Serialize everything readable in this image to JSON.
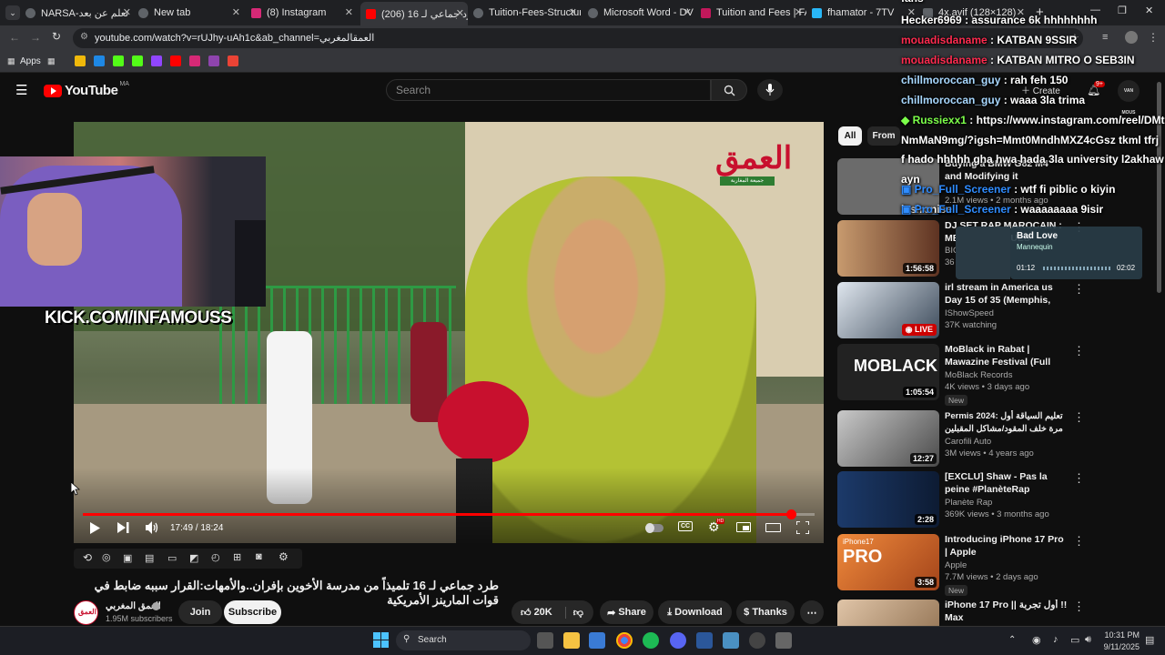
{
  "tabs": [
    {
      "label": "NARSA-تعلم عن بعد",
      "color": "#5f6368"
    },
    {
      "label": "New tab",
      "color": "#5f6368"
    },
    {
      "label": "(8) Instagram",
      "color": "#d62976"
    },
    {
      "label": "طرد جماعي لـ 16 (206)",
      "color": "#ff0000"
    },
    {
      "label": "Tuition-Fees-Structur",
      "color": "#5f6368"
    },
    {
      "label": "Microsoft Word - DV",
      "color": "#5f6368"
    },
    {
      "label": "Tuition and Fees | FA",
      "color": "#c2185b"
    },
    {
      "label": "fhamator - 7TV",
      "color": "#29b6f6"
    },
    {
      "label": "4x.avif (128×128)",
      "color": "#5f6368"
    }
  ],
  "url": "youtube.com/watch?v=rUJhy-uAh1c&ab_channel=العمقالمغربي",
  "bookmarks_label": "Apps",
  "youtube": {
    "logo_text": "YouTube",
    "region": "MA",
    "search_placeholder": "Search",
    "create_label": "Create",
    "notif_count": "9+",
    "avatar_text": "VAN MOUS"
  },
  "chat_overlay": {
    "header": "fans",
    "messages": [
      {
        "user": "Hecker6969",
        "text": "assurance 6k hhhhhhhh",
        "color": "#ffffff"
      },
      {
        "user": "mouadisdaname",
        "text": "KATBAN 9SSIR",
        "color": "#ff2b4f"
      },
      {
        "user": "mouadisdaname",
        "text": "KATBAN MITRO O SEB3IN",
        "color": "#ff2b4f"
      },
      {
        "user": "chillmoroccan_guy",
        "text": "rah feh 150",
        "color": "#a8d8ff"
      },
      {
        "user": "chillmoroccan_guy",
        "text": "waaa 3la trima",
        "color": "#a8d8ff"
      },
      {
        "user": "Russiexx1",
        "text": "https://www.instagram.com/reel/DMtNmMaN9mg/?igsh=Mmt0MndhMXZ4cGsz tkml tfrj f hado hhhhh gha hwa hada 3la university l2akhawayn",
        "color": "#7cff4a"
      },
      {
        "user": "Pro_Full_Screener",
        "text": "wtf fi piblic o kiyin lasironise",
        "color": "#2f8cff"
      },
      {
        "user": "Pro_Full_Screener",
        "text": "waaaaaaaa 9isir",
        "color": "#2f8cff"
      }
    ]
  },
  "now_playing": {
    "title": "Bad Love",
    "artist": "Mannequin",
    "elapsed": "01:12",
    "total": "02:02"
  },
  "stream_overlay": {
    "kick": "KICK.COM/INFAMOUSS"
  },
  "player": {
    "time": "17:49 / 18:24",
    "progress_fraction": 0.968,
    "video_watermark": "العمق",
    "video_subwatermark": "جميعة المغاربة"
  },
  "chips": {
    "all": "All",
    "from": "From"
  },
  "recommendations": [
    {
      "title": "Buying a BMW G82 M4 and Modifying it Immediately",
      "channel": "",
      "meta": "2.1M views • 2 months ago",
      "duration": "",
      "badge": "",
      "thumb": "#6b6b6b"
    },
    {
      "title": "DJ SET RAP MAROCAIN : MES CLASSIQUES",
      "channel": "BIG",
      "meta": "36",
      "duration": "1:56:58",
      "badge": "",
      "thumb": "#7a4a3a"
    },
    {
      "title": "irl stream in America us Day 15 of 35 (Memphis, TN)",
      "channel": "IShowSpeed",
      "meta": "37K watching",
      "duration": "",
      "live": "LIVE",
      "badge": "",
      "thumb": "#3c4a5a"
    },
    {
      "title": "MoBlack in Rabat | Mawazine Festival (Full Set)",
      "channel": "MoBlack Records",
      "meta": "4K views • 3 days ago",
      "duration": "1:05:54",
      "badge": "New",
      "thumb": "#222222"
    },
    {
      "title": "Permis 2024: تعليم السياقة أول مرة خلف المقود/مشاكل المقبلين عليه",
      "channel": "Carofili Auto",
      "meta": "3M views • 4 years ago",
      "duration": "12:27",
      "badge": "",
      "thumb": "#8a8a8a"
    },
    {
      "title": "[EXCLU] Shaw - Pas la peine #PlanèteRap",
      "channel": "Planète Rap",
      "meta": "369K views • 3 months ago",
      "duration": "2:28",
      "badge": "",
      "thumb": "#1c3a6a"
    },
    {
      "title": "Introducing iPhone 17 Pro | Apple",
      "channel": "Apple",
      "meta": "7.7M views • 2 days ago",
      "duration": "3:58",
      "badge": "New",
      "thumb": "#d2691e"
    },
    {
      "title": "iPhone 17 Pro || أول تجربة !! Max",
      "channel": "",
      "meta": "",
      "duration": "",
      "badge": "",
      "thumb": "#c9a07a"
    }
  ],
  "video_title": "طرد جماعي لـ 16 تلميذاً من مدرسة الأخوين بإفران..والأمهات:القرار سببه ضابط في قوات المارينز الأمريكية",
  "channel": {
    "name": "العمق المغربي",
    "subscribers": "1.95M subscribers",
    "join": "Join",
    "subscribe": "Subscribe"
  },
  "actions": {
    "likes": "20K",
    "share": "Share",
    "download": "Download",
    "thanks": "Thanks"
  },
  "taskbar": {
    "search": "Search",
    "time": "10:31 PM",
    "date": "9/11/2025"
  }
}
